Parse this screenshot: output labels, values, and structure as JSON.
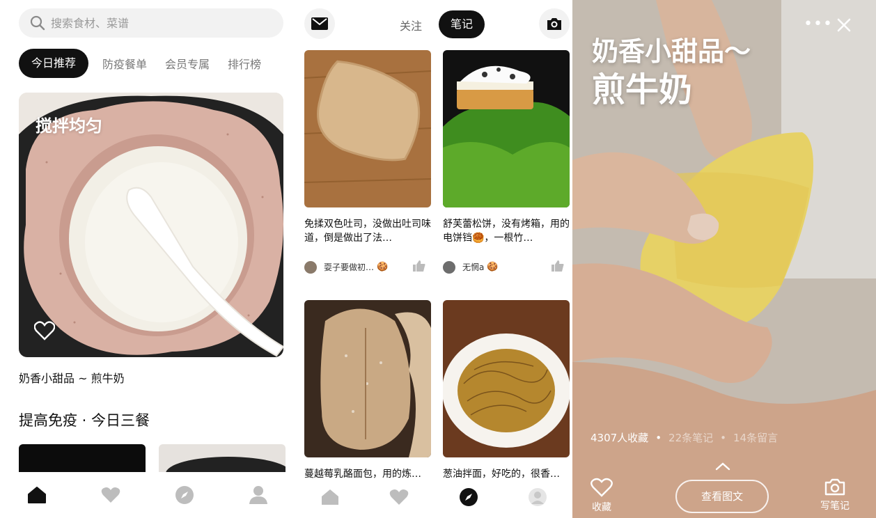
{
  "left": {
    "search": {
      "placeholder": "搜索食材、菜谱"
    },
    "tabs": [
      "今日推荐",
      "防疫餐单",
      "会员专属",
      "排行榜"
    ],
    "hero_overlay_text": "搅拌均匀",
    "recipe_title": "奶香小甜品 ~ 煎牛奶",
    "section_title": "提高免疫 · 今日三餐",
    "tabbar": [
      "home-icon",
      "heart-icon",
      "compass-icon",
      "user-icon"
    ]
  },
  "middle": {
    "tabs": {
      "follow": "关注",
      "notes": "笔记"
    },
    "cards": [
      {
        "desc": "免揉双色吐司，没做出吐司味道，倒是做出了法…",
        "author": "耍子要做初…",
        "badge": "🍪"
      },
      {
        "desc": "舒芙蕾松饼，没有烤箱，用的电饼铛🥮，一根竹…",
        "author": "无惘a",
        "badge": "🍪"
      },
      {
        "desc": "蔓越莓乳酪面包，用的炼…",
        "author": "",
        "badge": ""
      },
      {
        "desc": "葱油拌面，好吃的，很香…",
        "author": "",
        "badge": ""
      }
    ],
    "tabbar": [
      "home-icon",
      "heart-icon",
      "compass-icon",
      "avatar"
    ]
  },
  "right": {
    "title_line1": "奶香小甜品～",
    "title_line2": "煎牛奶",
    "stats": {
      "favorites": "4307人收藏",
      "notes": "22条笔记",
      "comments": "14条留言"
    },
    "favorite_label": "收藏",
    "view_button": "查看图文",
    "write_label": "写笔记"
  },
  "colors": {
    "accent": "#111111",
    "badge": "#d9a21b",
    "search_bg": "#f2f2f2"
  }
}
